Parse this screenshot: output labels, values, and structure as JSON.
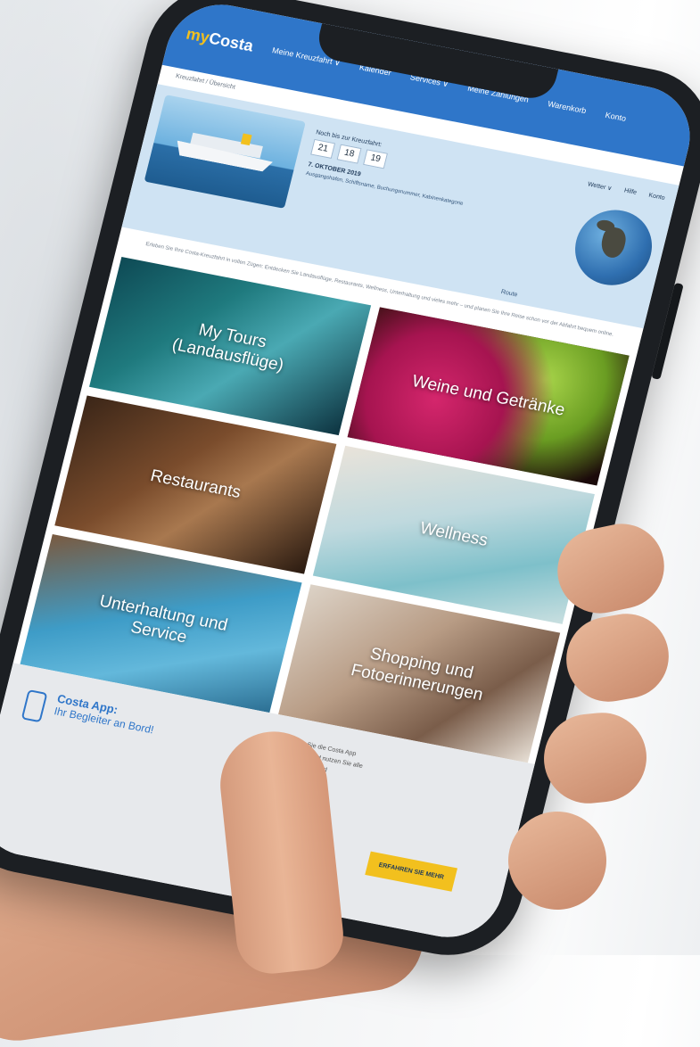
{
  "nav": {
    "logo_my": "my",
    "logo_brand": "Costa",
    "items": [
      "Meine Kreuzfahrt ∨",
      "Kalender",
      "Services ∨",
      "Meine Zahlungen",
      "Warenkorb",
      "Konto"
    ]
  },
  "breadcrumb": "Kreuzfahrt / Übersicht",
  "banner": {
    "countdown_label": "Noch bis zur Kreuzfahrt:",
    "countdown": [
      "21",
      "18",
      "19"
    ],
    "date": "7. OKTOBER 2019",
    "details": "Ausgangshafen, Schiffsname, Buchungsnummer, Kabinenkategorie",
    "menu": [
      "Wetter ∨",
      "Hilfe",
      "Konto"
    ],
    "globe_caption": "Route"
  },
  "intro": "Erleben Sie Ihre Costa-Kreuzfahrt in vollen Zügen: Entdecken Sie Landausflüge, Restaurants, Wellness, Unterhaltung und vieles mehr – und planen Sie Ihre Reise schon vor der Abfahrt bequem online.",
  "tiles": [
    {
      "label": "My Tours\n(Landausflüge)"
    },
    {
      "label": "Weine und Getränke"
    },
    {
      "label": "Restaurants"
    },
    {
      "label": "Wellness"
    },
    {
      "label": "Unterhaltung und\nService"
    },
    {
      "label": "Shopping und\nFotoerinnerungen"
    }
  ],
  "footer": {
    "app_title": "Costa App:",
    "app_sub": "Ihr Begleiter an Bord!",
    "blurb": "Laden Sie die Costa App herunter und nutzen Sie alle Vorteile an Bord",
    "cta": "ERFAHREN SIE MEHR"
  },
  "colors": {
    "brand_blue": "#2f76c9",
    "brand_yellow": "#f2c01e"
  }
}
